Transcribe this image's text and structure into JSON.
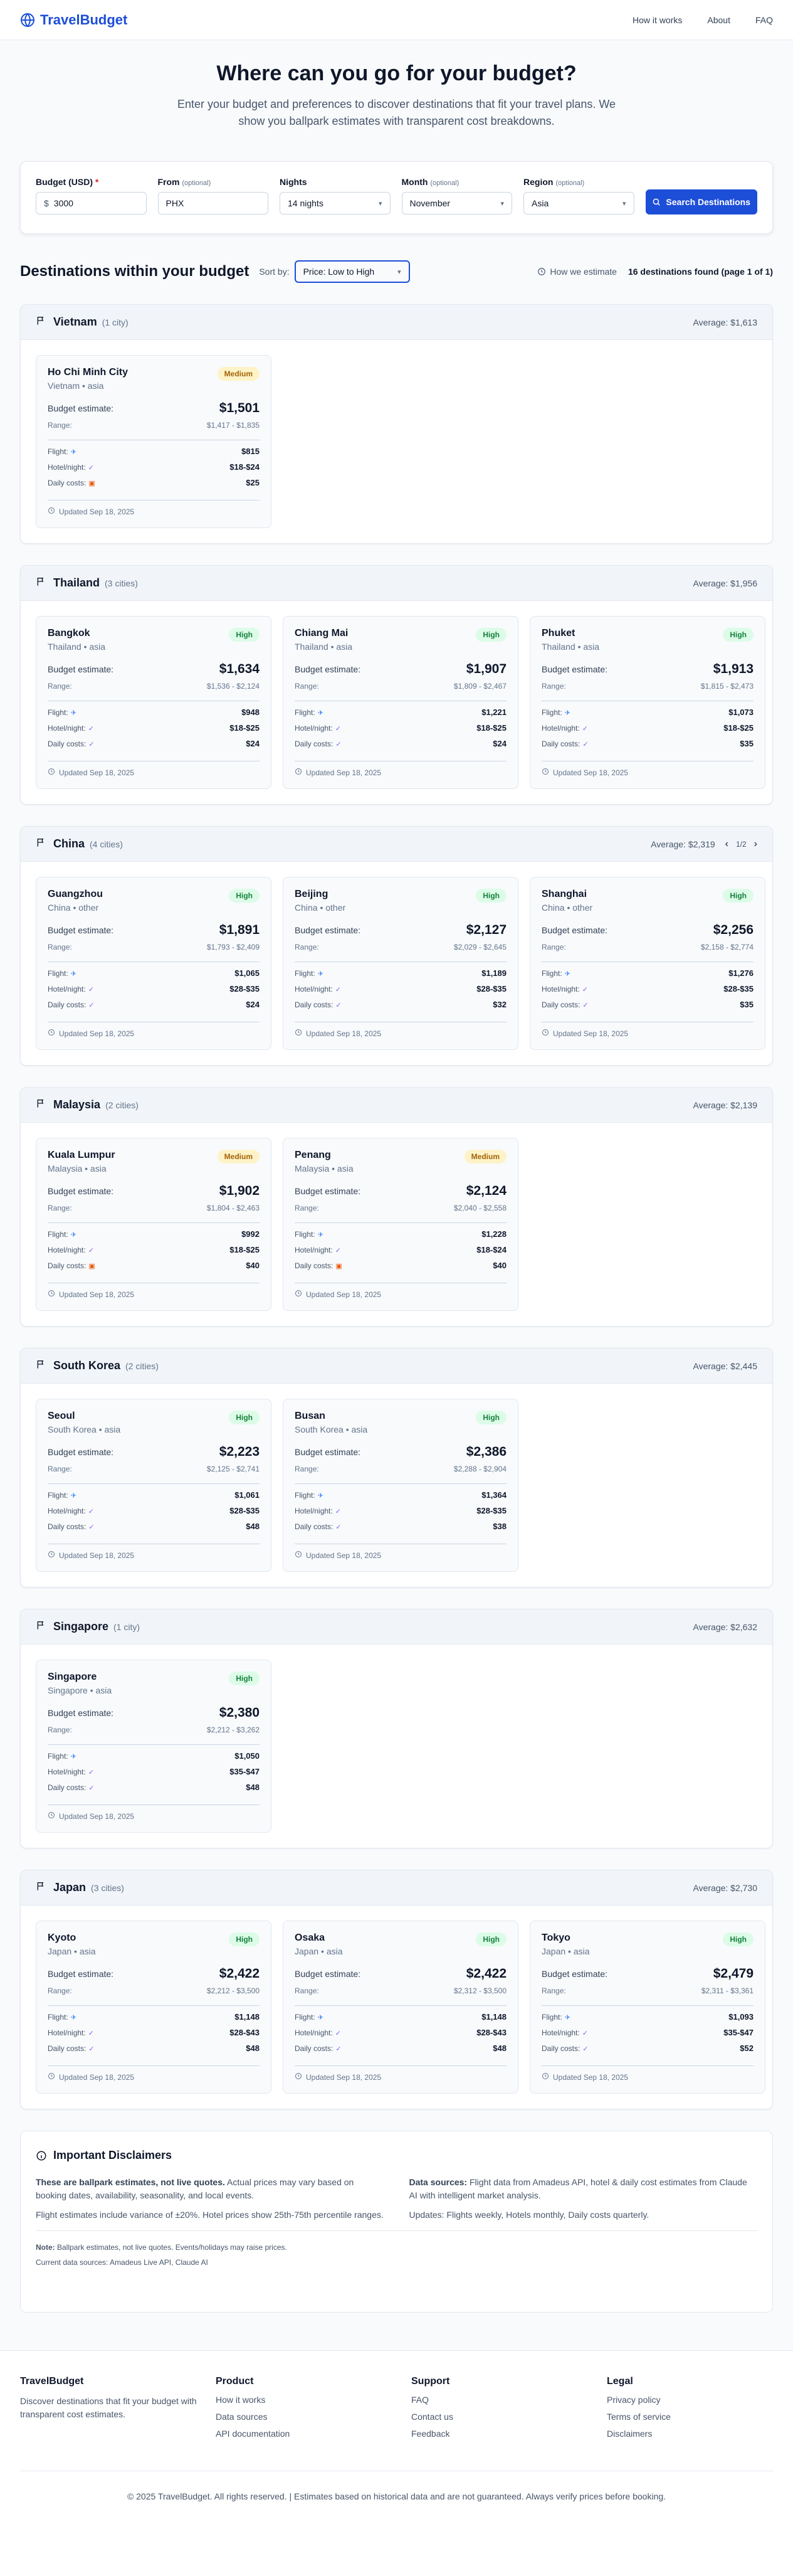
{
  "brand": "TravelBudget",
  "nav": [
    "How it works",
    "About",
    "FAQ"
  ],
  "hero": {
    "title": "Where can you go for your budget?",
    "subtitle": "Enter your budget and preferences to discover destinations that fit your travel plans. We show you ballpark estimates with transparent cost breakdowns."
  },
  "search": {
    "budget_label": "Budget (USD)",
    "budget_required": "*",
    "budget_prefix": "$",
    "budget_value": "3000",
    "from_label": "From",
    "from_value": "PHX",
    "nights_label": "Nights",
    "nights_value": "14 nights",
    "month_label": "Month",
    "month_value": "November",
    "region_label": "Region",
    "region_value": "Asia",
    "optional": "(optional)",
    "button": "Search Destinations"
  },
  "results": {
    "title": "Destinations within your budget",
    "sort_label": "Sort by:",
    "sort_value": "Price: Low to High",
    "estimate_link": "How we estimate",
    "found": "16 destinations found (page 1 of 1)"
  },
  "labels": {
    "budget_estimate": "Budget estimate:",
    "range": "Range:",
    "flight": "Flight:",
    "hotel": "Hotel/night:",
    "daily": "Daily costs:",
    "updated": "Updated Sep 18, 2025"
  },
  "countries": [
    {
      "name": "Vietnam",
      "count": "(1 city)",
      "avg": "Average: $1,613",
      "cities": [
        {
          "city": "Ho Chi Minh City",
          "sub": "Vietnam • asia",
          "badge": "Medium",
          "budget": "$1,501",
          "range": "$1,417 - $1,835",
          "flight": "$815",
          "hotel": "$18-$24",
          "daily": "$25",
          "daily_warn": true
        }
      ]
    },
    {
      "name": "Thailand",
      "count": "(3 cities)",
      "avg": "Average: $1,956",
      "cities": [
        {
          "city": "Bangkok",
          "sub": "Thailand • asia",
          "badge": "High",
          "budget": "$1,634",
          "range": "$1,536 - $2,124",
          "flight": "$948",
          "hotel": "$18-$25",
          "daily": "$24",
          "daily_warn": false
        },
        {
          "city": "Chiang Mai",
          "sub": "Thailand • asia",
          "badge": "High",
          "budget": "$1,907",
          "range": "$1,809 - $2,467",
          "flight": "$1,221",
          "hotel": "$18-$25",
          "daily": "$24",
          "daily_warn": false
        },
        {
          "city": "Phuket",
          "sub": "Thailand • asia",
          "badge": "High",
          "budget": "$1,913",
          "range": "$1,815 - $2,473",
          "flight": "$1,073",
          "hotel": "$18-$25",
          "daily": "$35",
          "daily_warn": false
        }
      ]
    },
    {
      "name": "China",
      "count": "(4 cities)",
      "avg": "Average: $2,319",
      "pager": "1/2",
      "cities": [
        {
          "city": "Guangzhou",
          "sub": "China • other",
          "badge": "High",
          "budget": "$1,891",
          "range": "$1,793 - $2,409",
          "flight": "$1,065",
          "hotel": "$28-$35",
          "daily": "$24",
          "daily_warn": false
        },
        {
          "city": "Beijing",
          "sub": "China • other",
          "badge": "High",
          "budget": "$2,127",
          "range": "$2,029 - $2,645",
          "flight": "$1,189",
          "hotel": "$28-$35",
          "daily": "$32",
          "daily_warn": false
        },
        {
          "city": "Shanghai",
          "sub": "China • other",
          "badge": "High",
          "budget": "$2,256",
          "range": "$2,158 - $2,774",
          "flight": "$1,276",
          "hotel": "$28-$35",
          "daily": "$35",
          "daily_warn": false
        }
      ]
    },
    {
      "name": "Malaysia",
      "count": "(2 cities)",
      "avg": "Average: $2,139",
      "cities": [
        {
          "city": "Kuala Lumpur",
          "sub": "Malaysia • asia",
          "badge": "Medium",
          "budget": "$1,902",
          "range": "$1,804 - $2,463",
          "flight": "$992",
          "hotel": "$18-$25",
          "daily": "$40",
          "daily_warn": true
        },
        {
          "city": "Penang",
          "sub": "Malaysia • asia",
          "badge": "Medium",
          "budget": "$2,124",
          "range": "$2,040 - $2,558",
          "flight": "$1,228",
          "hotel": "$18-$24",
          "daily": "$40",
          "daily_warn": true
        }
      ]
    },
    {
      "name": "South Korea",
      "count": "(2 cities)",
      "avg": "Average: $2,445",
      "cities": [
        {
          "city": "Seoul",
          "sub": "South Korea • asia",
          "badge": "High",
          "budget": "$2,223",
          "range": "$2,125 - $2,741",
          "flight": "$1,061",
          "hotel": "$28-$35",
          "daily": "$48",
          "daily_warn": false
        },
        {
          "city": "Busan",
          "sub": "South Korea • asia",
          "badge": "High",
          "budget": "$2,386",
          "range": "$2,288 - $2,904",
          "flight": "$1,364",
          "hotel": "$28-$35",
          "daily": "$38",
          "daily_warn": false
        }
      ]
    },
    {
      "name": "Singapore",
      "count": "(1 city)",
      "avg": "Average: $2,632",
      "cities": [
        {
          "city": "Singapore",
          "sub": "Singapore • asia",
          "badge": "High",
          "budget": "$2,380",
          "range": "$2,212 - $3,262",
          "flight": "$1,050",
          "hotel": "$35-$47",
          "daily": "$48",
          "daily_warn": false
        }
      ]
    },
    {
      "name": "Japan",
      "count": "(3 cities)",
      "avg": "Average: $2,730",
      "cities": [
        {
          "city": "Kyoto",
          "sub": "Japan • asia",
          "badge": "High",
          "budget": "$2,422",
          "range": "$2,212 - $3,500",
          "flight": "$1,148",
          "hotel": "$28-$43",
          "daily": "$48",
          "daily_warn": false
        },
        {
          "city": "Osaka",
          "sub": "Japan • asia",
          "badge": "High",
          "budget": "$2,422",
          "range": "$2,312 - $3,500",
          "flight": "$1,148",
          "hotel": "$28-$43",
          "daily": "$48",
          "daily_warn": false
        },
        {
          "city": "Tokyo",
          "sub": "Japan • asia",
          "badge": "High",
          "budget": "$2,479",
          "range": "$2,311 - $3,361",
          "flight": "$1,093",
          "hotel": "$35-$47",
          "daily": "$52",
          "daily_warn": false
        }
      ]
    }
  ],
  "disclaimers": {
    "title": "Important Disclaimers",
    "left_bold": "These are ballpark estimates, not live quotes.",
    "left_text": " Actual prices may vary based on booking dates, availability, seasonality, and local events.",
    "left_p2": "Flight estimates include variance of ±20%. Hotel prices show 25th-75th percentile ranges.",
    "right_bold": "Data sources:",
    "right_text": " Flight data from Amadeus API, hotel & daily cost estimates from Claude AI with intelligent market analysis.",
    "right_p2": "Updates: Flights weekly, Hotels monthly, Daily costs quarterly.",
    "note_bold": "Note:",
    "note_text": " Ballpark estimates, not live quotes. Events/holidays may raise prices.",
    "current": "Current data sources: Amadeus Live API, Claude AI"
  },
  "footer": {
    "brand": "TravelBudget",
    "desc": "Discover destinations that fit your budget with transparent cost estimates.",
    "product_title": "Product",
    "product_links": [
      "How it works",
      "Data sources",
      "API documentation"
    ],
    "support_title": "Support",
    "support_links": [
      "FAQ",
      "Contact us",
      "Feedback"
    ],
    "legal_title": "Legal",
    "legal_links": [
      "Privacy policy",
      "Terms of service",
      "Disclaimers"
    ],
    "copyright": "© 2025 TravelBudget. All rights reserved. | Estimates based on historical data and are not guaranteed. Always verify prices before booking."
  },
  "colors": {
    "accent": "#1d4ed8",
    "high_badge": "#dcfce7",
    "medium_badge": "#fef3c7"
  }
}
